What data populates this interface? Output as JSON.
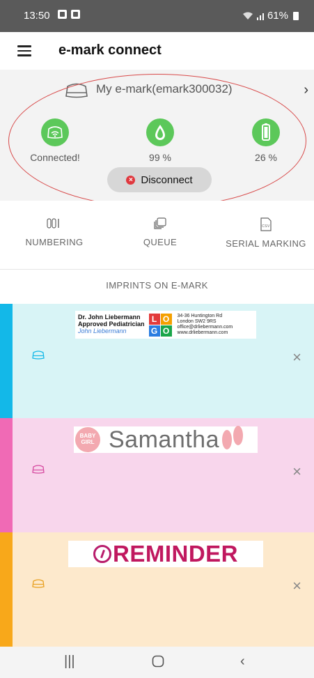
{
  "status_bar": {
    "time": "13:50",
    "battery": "61%"
  },
  "app_bar": {
    "title": "e-mark connect"
  },
  "device": {
    "name": "My e-mark(emark300032)",
    "connection_label": "Connected!",
    "ink_label": "99 %",
    "battery_label": "26 %",
    "disconnect_label": "Disconnect",
    "accent_color": "#5cc85a"
  },
  "toolbar": {
    "numbering_label": "NUMBERING",
    "queue_label": "QUEUE",
    "serial_label": "SERIAL MARKING",
    "csv_badge": "CSV"
  },
  "imprints_title": "IMPRINTS ON E-MARK",
  "imprints": [
    {
      "stripe_color": "#13b8e8",
      "bg_color": "#d8f4f6",
      "doctor_line1": "Dr. John Liebermann",
      "doctor_line2": "Approved Pediatrician",
      "signature": "John Liebermann",
      "logo_letters": [
        "L",
        "O",
        "G",
        "O"
      ],
      "address_line1": "34-36 Huntington Rd",
      "address_line2": "London SW2 9RS",
      "address_line3": "office@drliebermann.com",
      "address_line4": "www.drliebermann.com"
    },
    {
      "stripe_color": "#f06ab5",
      "bg_color": "#f8d6ec",
      "badge_line1": "BABY",
      "badge_line2": "GIRL",
      "name": "Samantha"
    },
    {
      "stripe_color": "#f8a81a",
      "bg_color": "#fde9cc",
      "word": "REMINDER"
    }
  ]
}
